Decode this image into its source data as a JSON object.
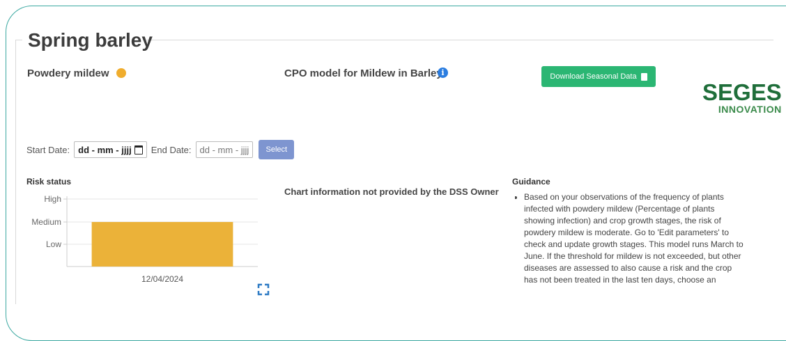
{
  "header": {
    "title": "Spring barley"
  },
  "disease": {
    "name": "Powdery mildew",
    "status_color": "#f0ad2d"
  },
  "model": {
    "title": "CPO model for Mildew in Barley",
    "info_icon": "info-icon"
  },
  "download": {
    "label": "Download Seasonal Data",
    "icon": "file-icon"
  },
  "logo": {
    "line1": "SEGES",
    "line2": "INNOVATION"
  },
  "dates": {
    "start_label": "Start Date:",
    "start_value": "dd - mm - jjjj",
    "end_label": "End Date:",
    "end_value": "dd - mm - jjjj",
    "select_label": "Select"
  },
  "risk": {
    "title": "Risk status"
  },
  "chart_info": "Chart information not provided by the DSS Owner",
  "guidance": {
    "title": "Guidance",
    "text": "Based on your observations of the frequency of plants infected with powdery mildew (Percentage of plants showing infection) and crop growth stages, the risk of powdery mildew is moderate. Go to 'Edit parameters' to check and update growth stages. This model runs March to June. If the threshold for mildew is not exceeded, but other diseases are assessed to also cause a risk and the crop has not been treated in the last ten days, choose an"
  },
  "chart_data": {
    "type": "bar",
    "categories": [
      "12/04/2024"
    ],
    "y_levels": [
      "Low",
      "Medium",
      "High"
    ],
    "values": [
      "Medium"
    ],
    "bar_color": "#ebb239",
    "grid": true
  }
}
